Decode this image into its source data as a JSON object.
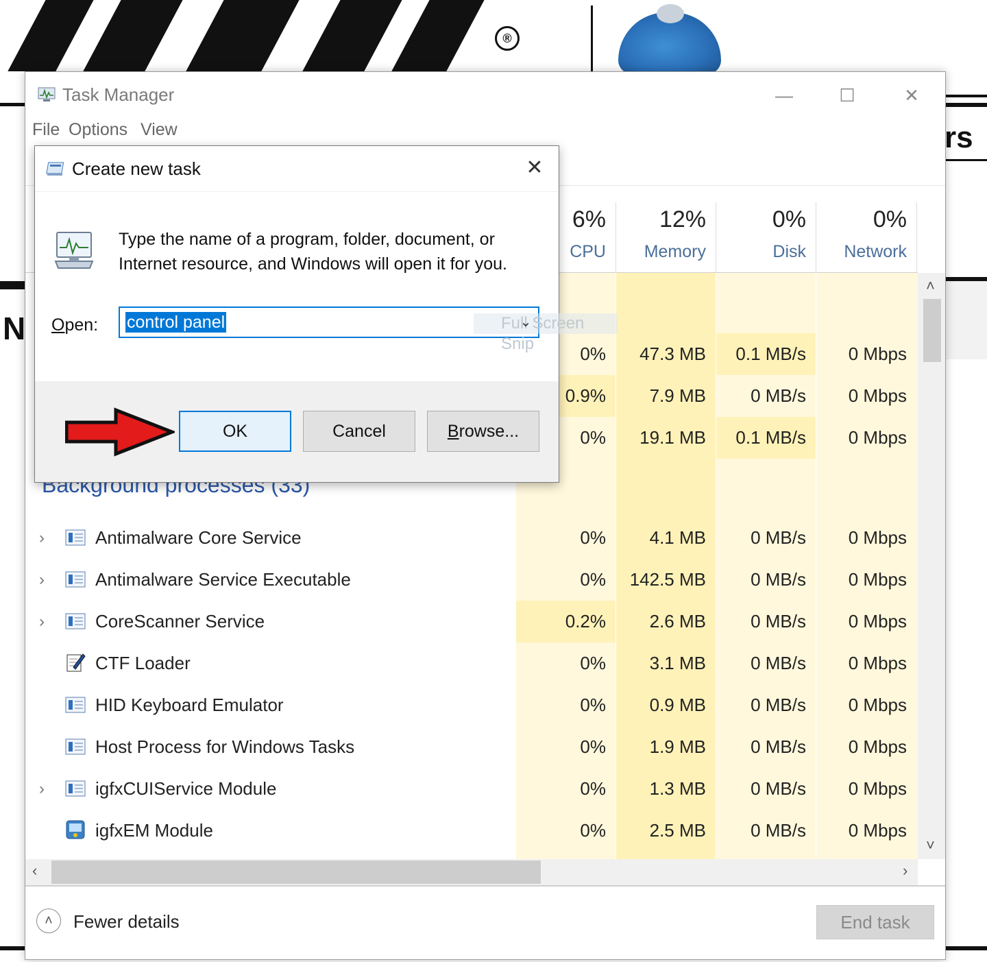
{
  "background": {
    "registered_mark": "®",
    "right_text": "rs",
    "left_letter": "N"
  },
  "task_manager": {
    "title": "Task Manager",
    "menu": [
      "File",
      "Options",
      "View"
    ],
    "columns": [
      {
        "pct": "6%",
        "label": "CPU"
      },
      {
        "pct": "12%",
        "label": "Memory"
      },
      {
        "pct": "0%",
        "label": "Disk"
      },
      {
        "pct": "0%",
        "label": "Network"
      }
    ],
    "apps_rows": [
      {
        "cpu": "0%",
        "memory": "47.3 MB",
        "disk": "0.1 MB/s",
        "network": "0 Mbps"
      },
      {
        "cpu": "0.9%",
        "memory": "7.9 MB",
        "disk": "0 MB/s",
        "network": "0 Mbps"
      },
      {
        "cpu": "0%",
        "memory": "19.1 MB",
        "disk": "0.1 MB/s",
        "network": "0 Mbps"
      }
    ],
    "section_title": "Background processes (33)",
    "processes": [
      {
        "name": "Antimalware Core Service",
        "expandable": true,
        "icon": "service-icon",
        "cpu": "0%",
        "memory": "4.1 MB",
        "disk": "0 MB/s",
        "network": "0 Mbps"
      },
      {
        "name": "Antimalware Service Executable",
        "expandable": true,
        "icon": "service-icon",
        "cpu": "0%",
        "memory": "142.5 MB",
        "disk": "0 MB/s",
        "network": "0 Mbps"
      },
      {
        "name": "CoreScanner Service",
        "expandable": true,
        "icon": "service-icon",
        "cpu": "0.2%",
        "memory": "2.6 MB",
        "disk": "0 MB/s",
        "network": "0 Mbps"
      },
      {
        "name": "CTF Loader",
        "expandable": false,
        "icon": "notepad-pen-icon",
        "cpu": "0%",
        "memory": "3.1 MB",
        "disk": "0 MB/s",
        "network": "0 Mbps"
      },
      {
        "name": "HID Keyboard Emulator",
        "expandable": false,
        "icon": "service-icon",
        "cpu": "0%",
        "memory": "0.9 MB",
        "disk": "0 MB/s",
        "network": "0 Mbps"
      },
      {
        "name": "Host Process for Windows Tasks",
        "expandable": false,
        "icon": "service-icon",
        "cpu": "0%",
        "memory": "1.9 MB",
        "disk": "0 MB/s",
        "network": "0 Mbps"
      },
      {
        "name": "igfxCUIService Module",
        "expandable": true,
        "icon": "service-icon",
        "cpu": "0%",
        "memory": "1.3 MB",
        "disk": "0 MB/s",
        "network": "0 Mbps"
      },
      {
        "name": "igfxEM Module",
        "expandable": false,
        "icon": "graphics-module-icon",
        "cpu": "0%",
        "memory": "2.5 MB",
        "disk": "0 MB/s",
        "network": "0 Mbps"
      }
    ],
    "fewer_details": "Fewer details",
    "end_task": "End task"
  },
  "dialog": {
    "title": "Create new task",
    "description": "Type the name of a program, folder, document, or Internet resource, and Windows will open it for you.",
    "open_label": "Open:",
    "open_label_underlined": "O",
    "open_label_rest": "pen:",
    "open_value": "control panel",
    "snip_overlay": "Full Screen Snip",
    "ok": "OK",
    "cancel": "Cancel",
    "browse_underlined": "B",
    "browse_rest": "rowse..."
  },
  "colors": {
    "heat_light": "#fff8dc",
    "heat_medium": "#fff2b8",
    "accent": "#0078d7",
    "section_title": "#2a58a8",
    "arrow": "#e31b1b"
  }
}
